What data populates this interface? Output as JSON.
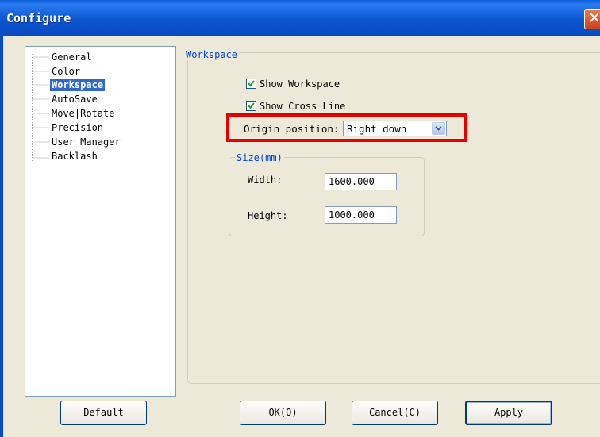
{
  "window": {
    "title": "Configure"
  },
  "tree": {
    "items": [
      {
        "label": "General",
        "selected": false
      },
      {
        "label": "Color",
        "selected": false
      },
      {
        "label": "Workspace",
        "selected": true
      },
      {
        "label": "AutoSave",
        "selected": false
      },
      {
        "label": "Move|Rotate",
        "selected": false
      },
      {
        "label": "Precision",
        "selected": false
      },
      {
        "label": "User Manager",
        "selected": false
      },
      {
        "label": "Backlash",
        "selected": false
      }
    ]
  },
  "workspace": {
    "group_title": "Workspace",
    "show_workspace": {
      "label": "Show Workspace",
      "checked": true
    },
    "show_cross_line": {
      "label": "Show Cross Line",
      "checked": true
    },
    "origin_position": {
      "label": "Origin position:",
      "value": "Right down"
    },
    "size_group": {
      "title": "Size(mm)",
      "width_label": "Width:",
      "width_value": "1600.000",
      "height_label": "Height:",
      "height_value": "1000.000"
    }
  },
  "buttons": {
    "default": "Default",
    "ok": "OK(O)",
    "cancel": "Cancel(C)",
    "apply": "Apply"
  },
  "colors": {
    "titlebar": "#0a55d0",
    "selection": "#316ac5",
    "highlight": "#e30000",
    "group_title": "#0046d5",
    "check": "#21a121"
  }
}
